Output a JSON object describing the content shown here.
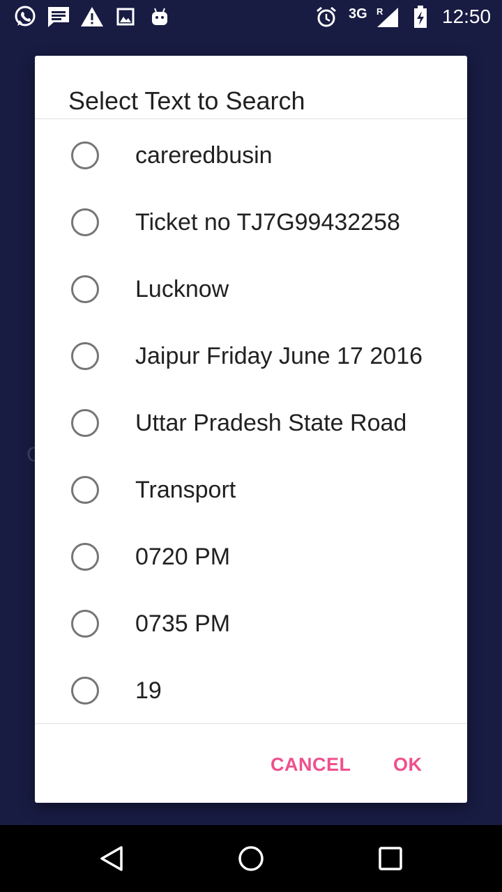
{
  "status_bar": {
    "network": "3G",
    "roaming": "R",
    "time": "12:50",
    "left_icons": [
      "whatsapp-icon",
      "message-icon",
      "warning-icon",
      "image-icon",
      "android-icon"
    ],
    "right_icons": [
      "alarm-icon",
      "signal-icon",
      "battery-charging-icon"
    ]
  },
  "dialog": {
    "title": "Select Text to Search",
    "options": [
      {
        "label": "careredbusin",
        "selected": false
      },
      {
        "label": "Ticket no TJ7G99432258",
        "selected": false
      },
      {
        "label": "Lucknow",
        "selected": false
      },
      {
        "label": "Jaipur Friday June 17 2016",
        "selected": false
      },
      {
        "label": "Uttar Pradesh State Road",
        "selected": false
      },
      {
        "label": "Transport",
        "selected": false
      },
      {
        "label": "0720 PM",
        "selected": false
      },
      {
        "label": "0735 PM",
        "selected": false
      },
      {
        "label": "19",
        "selected": false
      }
    ],
    "cancel_label": "CANCEL",
    "ok_label": "OK"
  },
  "nav_bar": {
    "icons": [
      "back-icon",
      "home-icon",
      "recents-icon"
    ]
  },
  "colors": {
    "status_bar_bg": "#181c43",
    "dialog_bg": "#ffffff",
    "accent": "#ef4f8c",
    "radio_border": "#757575",
    "text_primary": "#212121",
    "nav_bar_bg": "#000000"
  }
}
